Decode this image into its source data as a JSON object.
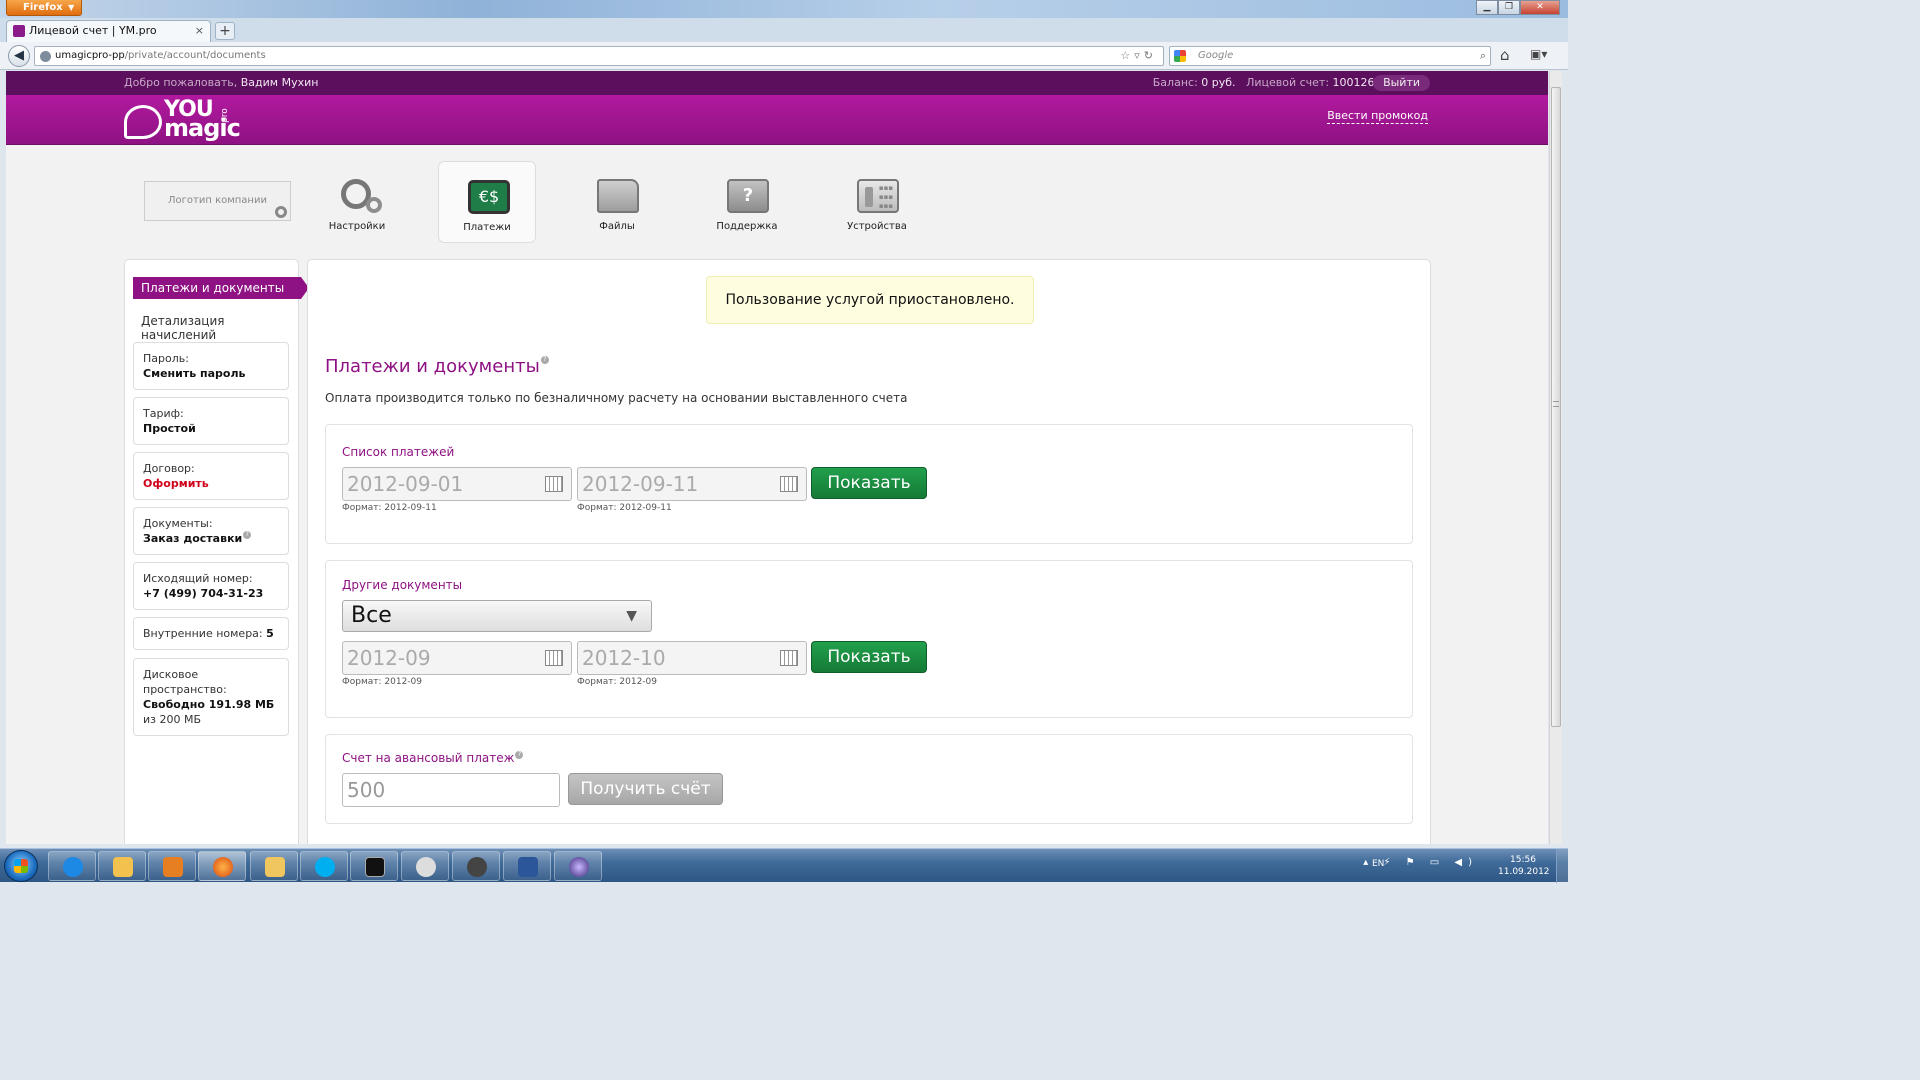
{
  "browser": {
    "menu_label": "Firefox",
    "tab_title": "Лицевой счет | YM.pro",
    "tab_close": "×",
    "new_tab": "+",
    "url_host": "umagicpro-pp",
    "url_path": "/private/account/documents",
    "search_placeholder": "Google"
  },
  "topbar": {
    "welcome_prefix": "Добро пожаловать,",
    "user_name": "Вадим Мухин",
    "balance_label": "Баланс:",
    "balance_value": "0 руб.",
    "account_label": "Лицевой счет:",
    "account_value": "100126",
    "logout": "Выйти"
  },
  "header": {
    "logo_you": "YOU",
    "logo_magic": "magic",
    "logo_pro": "pro",
    "promo_link": "Ввести промокод"
  },
  "toolbar": {
    "company_logo": "Логотип компании",
    "items": [
      {
        "label": "Настройки",
        "icon": "settings-gears-icon"
      },
      {
        "label": "Платежи",
        "icon": "payments-money-icon",
        "active": true,
        "glyph": "€$"
      },
      {
        "label": "Файлы",
        "icon": "files-folder-icon"
      },
      {
        "label": "Поддержка",
        "icon": "support-question-icon",
        "glyph": "?"
      },
      {
        "label": "Устройства",
        "icon": "devices-phone-icon"
      }
    ]
  },
  "sidebar": {
    "active_item": "Платежи и документы",
    "link": "Детализация начислений",
    "cards": [
      {
        "label": "Пароль:",
        "value": "Сменить пароль"
      },
      {
        "label": "Тариф:",
        "value": "Простой"
      },
      {
        "label": "Договор:",
        "value": "Оформить"
      },
      {
        "label": "Документы:",
        "value": "Заказ доставки"
      },
      {
        "label": "Исходящий номер:",
        "value": "+7 (499) 704-31-23"
      },
      {
        "label": "Внутренние номера:",
        "value": "5"
      },
      {
        "label": "Дисковое пространство:",
        "value": "Свободно 191.98 МБ",
        "extra": "из 200 МБ"
      }
    ]
  },
  "main": {
    "notice": "Пользование услугой приостановлено.",
    "title": "Платежи и документы",
    "subtitle": "Оплата производится только по безналичному расчету на основании выставленного счета",
    "payments": {
      "title": "Список платежей",
      "from": "2012-09-01",
      "to": "2012-09-11",
      "from_hint": "Формат: 2012-09-11",
      "to_hint": "Формат: 2012-09-11",
      "button": "Показать"
    },
    "documents": {
      "title": "Другие документы",
      "select_value": "Все",
      "from": "2012-09",
      "to": "2012-10",
      "from_hint": "Формат: 2012-09",
      "to_hint": "Формат: 2012-09",
      "button": "Показать"
    },
    "advance": {
      "title": "Счет на авансовый платеж",
      "amount": "500",
      "button": "Получить счёт"
    }
  },
  "taskbar": {
    "lang": "EN",
    "time": "15:56",
    "date": "11.09.2012",
    "apps": [
      "ie",
      "explorer",
      "media-player",
      "firefox",
      "mail",
      "skype",
      "cmd",
      "alien",
      "github",
      "word",
      "eclipse"
    ]
  },
  "colors": {
    "brand": "#8e1283",
    "brand_dark": "#5b0f5c",
    "green_button": "#1c8c42",
    "contract_red": "#d0021b"
  }
}
